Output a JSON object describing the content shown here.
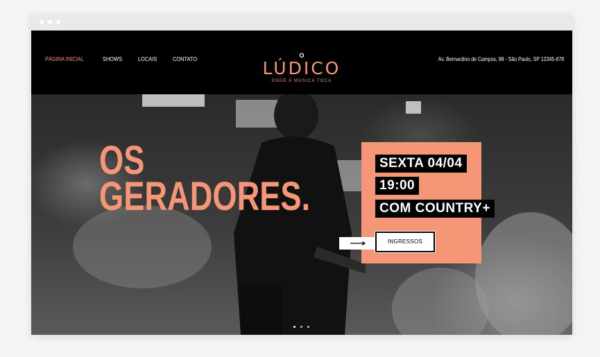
{
  "nav": {
    "items": [
      "PÁGINA INICIAL",
      "SHOWS",
      "LOCAIS",
      "CONTATO"
    ],
    "active_index": 0
  },
  "logo": {
    "prefix": "O",
    "name": "LÚDICO",
    "tagline": "ONDE A MÚSICA TOCA"
  },
  "address": "Av. Bernardino de Campos, 98 - São Paulo, SP 12345-678",
  "hero": {
    "title_line1": "OS",
    "title_line2": "GERADORES."
  },
  "event": {
    "day": "SEXTA 04/04",
    "time": "19:00",
    "guest": "COM COUNTRY+",
    "tickets_label": "INGRESSOS"
  },
  "slider": {
    "count": 3,
    "active_index": 0
  },
  "colors": {
    "accent": "#f59776",
    "header_bg": "#000000",
    "page_bg": "#f4f4f4"
  },
  "icons": [
    "arrow-right-icon"
  ]
}
